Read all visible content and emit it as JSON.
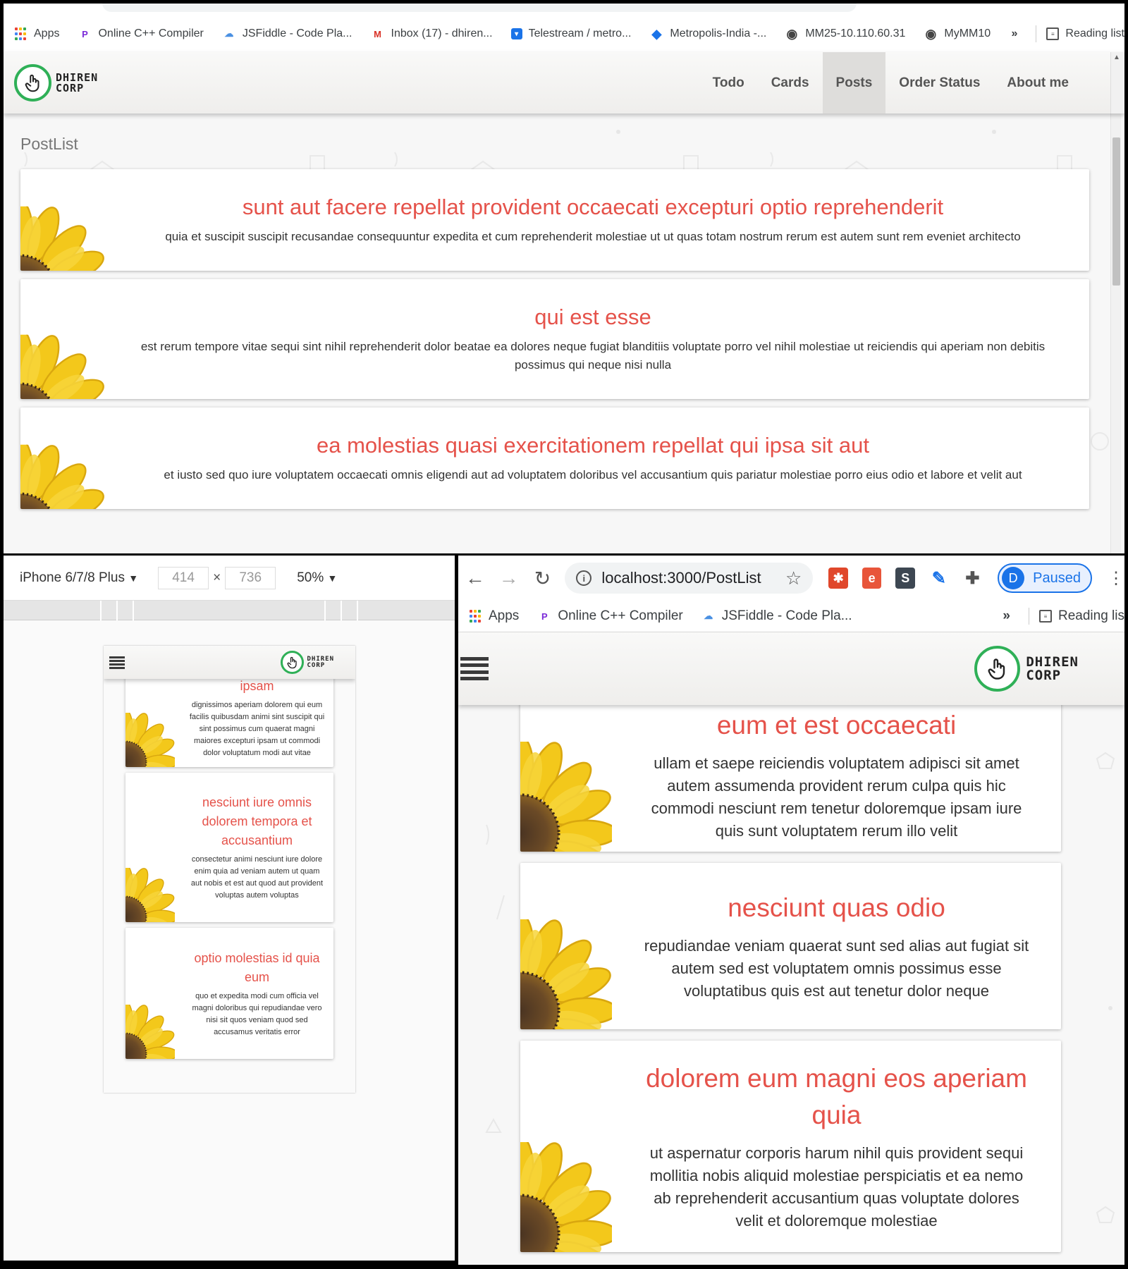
{
  "browser": {
    "url_text": "localhost:3000/PostList",
    "profile_initial": "D",
    "profile_status": "Paused",
    "bookmarks_full": [
      {
        "label": "Apps",
        "icon": "apps-grid-icon"
      },
      {
        "label": "Online C++ Compiler",
        "icon": "compiler-icon"
      },
      {
        "label": "JSFiddle - Code Pla...",
        "icon": "jsfiddle-cloud-icon"
      },
      {
        "label": "Inbox (17) - dhiren...",
        "icon": "gmail-icon"
      },
      {
        "label": "Telestream / metro...",
        "icon": "telestream-icon"
      },
      {
        "label": "Metropolis-India -...",
        "icon": "diamond-icon"
      },
      {
        "label": "MM25-10.110.60.31",
        "icon": "globe-icon"
      },
      {
        "label": "MyMM10",
        "icon": "globe-icon"
      }
    ],
    "bookmarks_short": [
      {
        "label": "Apps",
        "icon": "apps-grid-icon"
      },
      {
        "label": "Online C++ Compiler",
        "icon": "compiler-icon"
      },
      {
        "label": "JSFiddle - Code Pla...",
        "icon": "jsfiddle-cloud-icon"
      }
    ],
    "overflow_label": "»",
    "reading_list_full": "Reading list",
    "reading_list_cut": "Reading lis"
  },
  "app": {
    "logo_line1": "DHIREN",
    "logo_line2": "CORP",
    "nav": [
      "Todo",
      "Cards",
      "Posts",
      "Order Status",
      "About me"
    ],
    "active_nav": "Posts",
    "page_title": "PostList"
  },
  "devtools": {
    "device": "iPhone 6/7/8 Plus",
    "width": "414",
    "times": "×",
    "height": "736",
    "zoom": "50%"
  },
  "desktop_posts": [
    {
      "title": "sunt aut facere repellat provident occaecati excepturi optio reprehenderit",
      "body": "quia et suscipit suscipit recusandae consequuntur expedita et cum reprehenderit molestiae ut ut quas totam nostrum rerum est autem sunt rem eveniet architecto"
    },
    {
      "title": "qui est esse",
      "body": "est rerum tempore vitae sequi sint nihil reprehenderit dolor beatae ea dolores neque fugiat blanditiis voluptate porro vel nihil molestiae ut reiciendis qui aperiam non debitis possimus qui neque nisi nulla"
    },
    {
      "title": "ea molestias quasi exercitationem repellat qui ipsa sit aut",
      "body": "et iusto sed quo iure voluptatem occaecati omnis eligendi aut ad voluptatem doloribus vel accusantium quis pariatur molestiae porro eius odio et labore et velit aut"
    }
  ],
  "mobile_posts": [
    {
      "title": "ipsam",
      "body": "dignissimos aperiam dolorem qui eum facilis quibusdam animi sint suscipit qui sint possimus cum quaerat magni maiores excepturi ipsam ut commodi dolor voluptatum modi aut vitae"
    },
    {
      "title": "nesciunt iure omnis dolorem tempora et accusantium",
      "body": "consectetur animi nesciunt iure dolore enim quia ad veniam autem ut quam aut nobis et est aut quod aut provident voluptas autem voluptas"
    },
    {
      "title": "optio molestias id quia eum",
      "body": "quo et expedita modi cum officia vel magni doloribus qui repudiandae vero nisi sit quos veniam quod sed accusamus veritatis error"
    }
  ],
  "tablet_posts": [
    {
      "title": "eum et est occaecati",
      "body": "ullam et saepe reiciendis voluptatem adipisci sit amet autem assumenda provident rerum culpa quis hic commodi nesciunt rem tenetur doloremque ipsam iure quis sunt voluptatem rerum illo velit"
    },
    {
      "title": "nesciunt quas odio",
      "body": "repudiandae veniam quaerat sunt sed alias aut fugiat sit autem sed est voluptatem omnis possimus esse voluptatibus quis est aut tenetur dolor neque"
    },
    {
      "title": "dolorem eum magni eos aperiam quia",
      "body": "ut aspernatur corporis harum nihil quis provident sequi mollitia nobis aliquid molestiae perspiciatis et ea nemo ab reprehenderit accusantium quas voluptate dolores velit et doloremque molestiae"
    }
  ],
  "colors": {
    "accent_title": "#e5524a",
    "logo_ring": "#2fb057",
    "profile_blue": "#1a73e8"
  }
}
